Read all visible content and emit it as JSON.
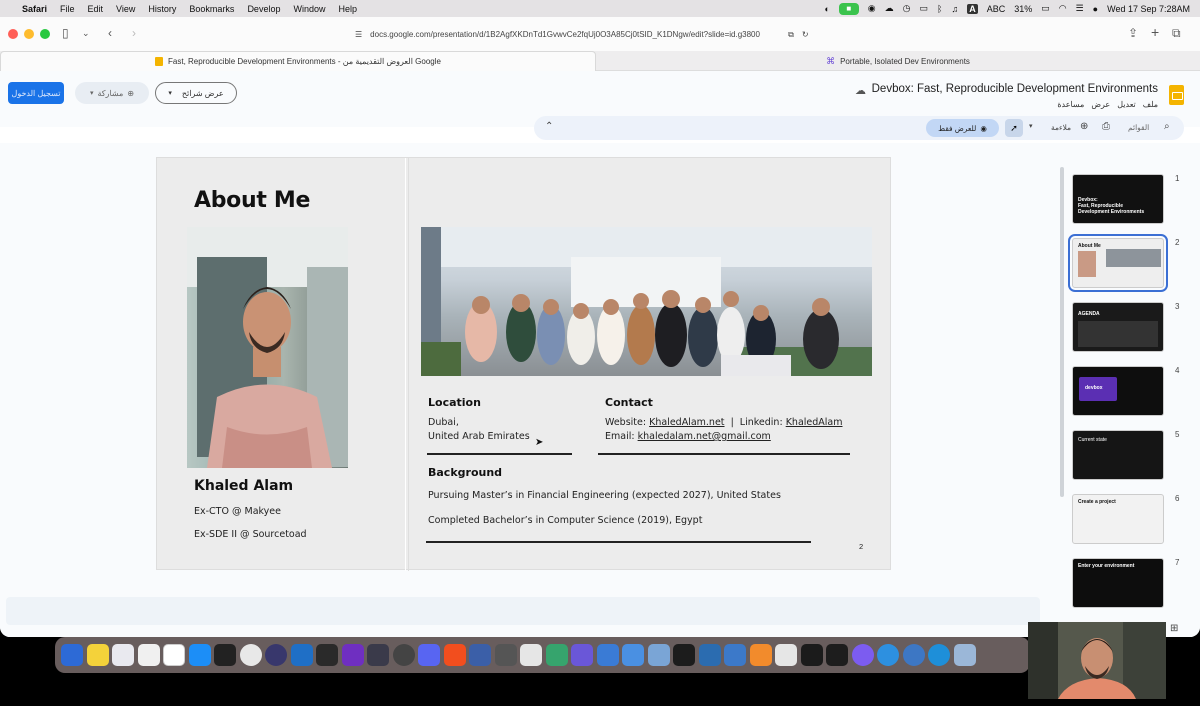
{
  "mac_menubar": {
    "apple": "",
    "app": "Safari",
    "items": [
      "File",
      "Edit",
      "View",
      "History",
      "Bookmarks",
      "Develop",
      "Window",
      "Help"
    ],
    "input_source": "ABC",
    "battery": "31%",
    "datetime": "Wed 17 Sep  7:28AM"
  },
  "browser": {
    "url": "docs.google.com/presentation/d/1B2AgfXKDnTd1GvwvCe2fqUj0O3A85Cj0tSID_K1DNgw/edit?slide=id.g3800",
    "tabs": [
      {
        "label": "Fast, Reproducible Development Environments - العروض التقديمية من Google",
        "active": true
      },
      {
        "label": "Portable, Isolated Dev Environments",
        "active": false
      }
    ]
  },
  "slides_app": {
    "doc_title": "Devbox:  Fast, Reproducible Development Environments",
    "menus": [
      "ملف",
      "تعديل",
      "عرض",
      "مساعدة"
    ],
    "start_button": "تسجيل الدخول",
    "share_button": "مشاركة",
    "slideshow_button": "عرض شرائح",
    "toolbar": {
      "search_placeholder": "القوائم",
      "fit_label": "ملاءمة",
      "view_only": "للعرض فقط"
    }
  },
  "slide": {
    "heading": "About Me",
    "name": "Khaled Alam",
    "roles": [
      "Ex-CTO @ Makyee",
      "Ex-SDE II @ Sourcetoad"
    ],
    "location": {
      "title": "Location",
      "lines": [
        "Dubai,",
        "United Arab Emirates"
      ]
    },
    "contact": {
      "title": "Contact",
      "website_label": "Website:",
      "website": "KhaledAlam.net",
      "sep": "|",
      "linkedin_label": "Linkedin:",
      "linkedin": "KhaledAlam",
      "email_label": "Email:",
      "email": "khaledalam.net@gmail.com"
    },
    "background": {
      "title": "Background",
      "lines": [
        "Pursuing Master’s in Financial Engineering (expected 2027), United States",
        "Completed Bachelor’s in Computer Science (2019), Egypt"
      ]
    },
    "page_number": "2"
  },
  "thumbnails": [
    {
      "num": "1",
      "text": "Devbox:\nFast, Reproducible\nDevelopment Environments",
      "bg": "#111111"
    },
    {
      "num": "2",
      "text": "About Me",
      "bg": "#eeeeee"
    },
    {
      "num": "3",
      "text": "AGENDA",
      "bg": "#1a1a1a"
    },
    {
      "num": "4",
      "text": "devbox",
      "bg": "#0e0e0e"
    },
    {
      "num": "5",
      "text": "Current state",
      "bg": "#151515"
    },
    {
      "num": "6",
      "text": "Create a project",
      "bg": "#f2f2f2"
    },
    {
      "num": "7",
      "text": "Enter your environment",
      "bg": "#0d0d0d"
    }
  ],
  "colors": {
    "accent": "#3b6fd4",
    "share_blue": "#1a73e8",
    "slides_yellow": "#f4b400"
  }
}
